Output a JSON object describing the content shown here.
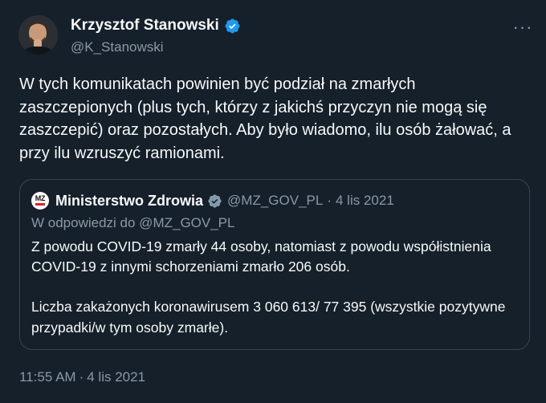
{
  "colors": {
    "background": "#15202b",
    "text_primary": "#f7f9f9",
    "text_secondary": "#8b98a5",
    "border": "#38444d",
    "verified_badge": "#1d9bf0"
  },
  "author": {
    "name": "Krzysztof Stanowski",
    "handle": "@K_Stanowski",
    "verified_icon": "verified-badge-icon",
    "more_icon": "more-dots-icon",
    "more_label": "···"
  },
  "tweet": {
    "text": "W tych komunikatach powinien być podział na zmarłych zaszczepionych (plus tych, którzy z jakichś przyczyn nie mogą się zaszczepić) oraz pozostałych. Aby było wiadomo, ilu osób żałować, a przy ilu wzruszyć ramionami.",
    "time": "11:55 AM",
    "separator": "·",
    "date": "4 lis 2021"
  },
  "quoted": {
    "logo_text": "MZ",
    "name": "Ministerstwo Zdrowia",
    "handle": "@MZ_GOV_PL",
    "separator": "·",
    "date": "4 lis 2021",
    "reply_to": "W odpowiedzi do @MZ_GOV_PL",
    "paragraph1": "Z powodu COVID-19 zmarły 44 osoby, natomiast z powodu współistnienia COVID-19 z innymi schorzeniami zmarło 206 osób.",
    "paragraph2": "Liczba zakażonych koronawirusem 3 060 613/ 77 395 (wszystkie pozytywne przypadki/w tym osoby zmarłe).",
    "verified_icon": "verified-gray-badge-icon"
  }
}
